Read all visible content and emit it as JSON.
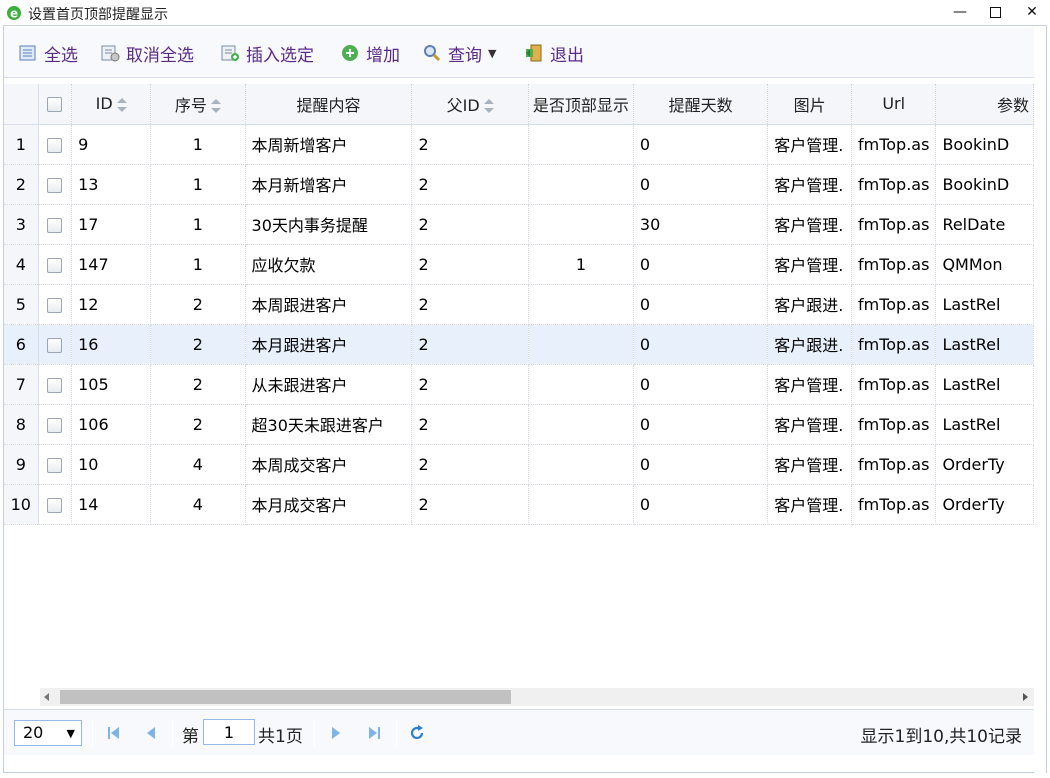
{
  "window": {
    "title": "设置首页顶部提醒显示",
    "icon": "ie-icon",
    "minimize": "—",
    "close": "✕"
  },
  "toolbar": {
    "select_all": "全选",
    "deselect_all": "取消全选",
    "insert_selected": "插入选定",
    "add": "增加",
    "query": "查询",
    "exit": "退出"
  },
  "columns": {
    "id": "ID",
    "seq": "序号",
    "content": "提醒内容",
    "parent_id": "父ID",
    "show_top": "是否顶部显示",
    "days": "提醒天数",
    "image": "图片",
    "url": "Url",
    "param": "参数"
  },
  "rows": [
    {
      "n": "1",
      "id": "9",
      "seq": "1",
      "content": "本周新增客户",
      "parent_id": "2",
      "show_top": "",
      "days": "0",
      "image": "客户管理.",
      "url": "fmTop.as",
      "param": "BookinD"
    },
    {
      "n": "2",
      "id": "13",
      "seq": "1",
      "content": "本月新增客户",
      "parent_id": "2",
      "show_top": "",
      "days": "0",
      "image": "客户管理.",
      "url": "fmTop.as",
      "param": "BookinD"
    },
    {
      "n": "3",
      "id": "17",
      "seq": "1",
      "content": "30天内事务提醒",
      "parent_id": "2",
      "show_top": "",
      "days": "30",
      "image": "客户管理.",
      "url": "fmTop.as",
      "param": "RelDate"
    },
    {
      "n": "4",
      "id": "147",
      "seq": "1",
      "content": "应收欠款",
      "parent_id": "2",
      "show_top": "1",
      "days": "0",
      "image": "客户管理.",
      "url": "fmTop.as",
      "param": "QMMon"
    },
    {
      "n": "5",
      "id": "12",
      "seq": "2",
      "content": "本周跟进客户",
      "parent_id": "2",
      "show_top": "",
      "days": "0",
      "image": "客户跟进.",
      "url": "fmTop.as",
      "param": "LastRel"
    },
    {
      "n": "6",
      "id": "16",
      "seq": "2",
      "content": "本月跟进客户",
      "parent_id": "2",
      "show_top": "",
      "days": "0",
      "image": "客户跟进.",
      "url": "fmTop.as",
      "param": "LastRel"
    },
    {
      "n": "7",
      "id": "105",
      "seq": "2",
      "content": "从未跟进客户",
      "parent_id": "2",
      "show_top": "",
      "days": "0",
      "image": "客户管理.",
      "url": "fmTop.as",
      "param": "LastRel"
    },
    {
      "n": "8",
      "id": "106",
      "seq": "2",
      "content": "超30天未跟进客户",
      "parent_id": "2",
      "show_top": "",
      "days": "0",
      "image": "客户管理.",
      "url": "fmTop.as",
      "param": "LastRel"
    },
    {
      "n": "9",
      "id": "10",
      "seq": "4",
      "content": "本周成交客户",
      "parent_id": "2",
      "show_top": "",
      "days": "0",
      "image": "客户管理.",
      "url": "fmTop.as",
      "param": "OrderTy"
    },
    {
      "n": "10",
      "id": "14",
      "seq": "4",
      "content": "本月成交客户",
      "parent_id": "2",
      "show_top": "",
      "days": "0",
      "image": "客户管理.",
      "url": "fmTop.as",
      "param": "OrderTy"
    }
  ],
  "highlighted_row": 6,
  "pager": {
    "page_size": "20",
    "page_prefix": "第",
    "page_value": "1",
    "page_suffix": "共1页",
    "info": "显示1到10,共10记录"
  },
  "colors": {
    "toolbar_text": "#5b2a86",
    "header_bg": "#f4f6fa",
    "highlight_row": "#e8f0fb",
    "pager_icon": "#4a90d9"
  }
}
